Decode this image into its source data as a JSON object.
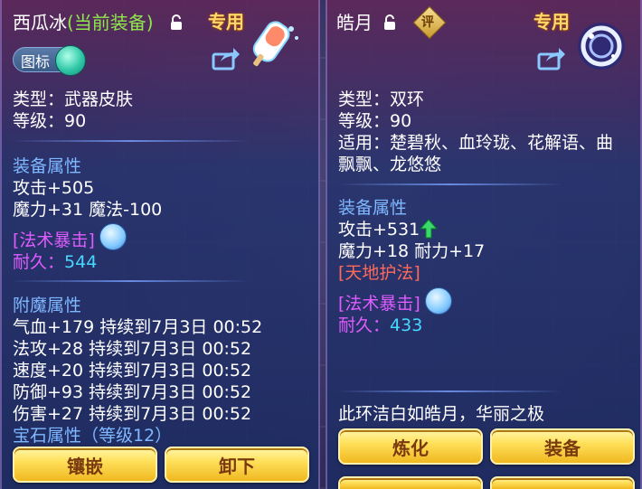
{
  "left": {
    "name": "西瓜冰",
    "equipped_tag": "(当前装备)",
    "exclusive": "专用",
    "icon_toggle_label": "图标",
    "type_line": "类型：武器皮肤",
    "level_line": "等级：90",
    "equip_attr_title": "装备属性",
    "attack_line": "攻击+505",
    "magic_line": "魔力+31 魔法-100",
    "special_skill": "[法术暴击]",
    "durability_label": "耐久：",
    "durability_value": "544",
    "enchant_title": "附魔属性",
    "enchants": [
      "气血+179 持续到7月3日 00:52",
      "法攻+28 持续到7月3日 00:52",
      "速度+20 持续到7月3日 00:52",
      "防御+93 持续到7月3日 00:52",
      "伤害+27 持续到7月3日 00:52"
    ],
    "gem_line": "宝石属性（等级12）",
    "btn_inlay": "镶嵌",
    "btn_unequip": "卸下"
  },
  "right": {
    "name": "皓月",
    "evaluate_badge": "评",
    "exclusive": "专用",
    "type_line": "类型：双环",
    "level_line": "等级：90",
    "suitable_line1": "适用：楚碧秋、血玲珑、花解语、曲",
    "suitable_line2": "飘飘、龙悠悠",
    "equip_attr_title": "装备属性",
    "attack_line": "攻击+531",
    "magic_line": "魔力+18 耐力+17",
    "special1": "[天地护法]",
    "special2": "[法术暴击]",
    "durability_label": "耐久：",
    "durability_value": "433",
    "description": "此环洁白如皓月，华丽之极",
    "btn_refine": "炼化",
    "btn_equip": "装备"
  },
  "colors": {
    "highlight_green": "#8ee84a",
    "section_blue": "#7fb8ff",
    "skill_magenta": "#e05cff",
    "value_cyan": "#48d8ff",
    "skill_red": "#ff6a5a",
    "button_gold": "#ffe05a"
  },
  "icons": [
    "lock-icon",
    "share-icon",
    "popsicle-icon",
    "moon-ring-icon",
    "refresh-icon",
    "up-arrow-icon"
  ]
}
